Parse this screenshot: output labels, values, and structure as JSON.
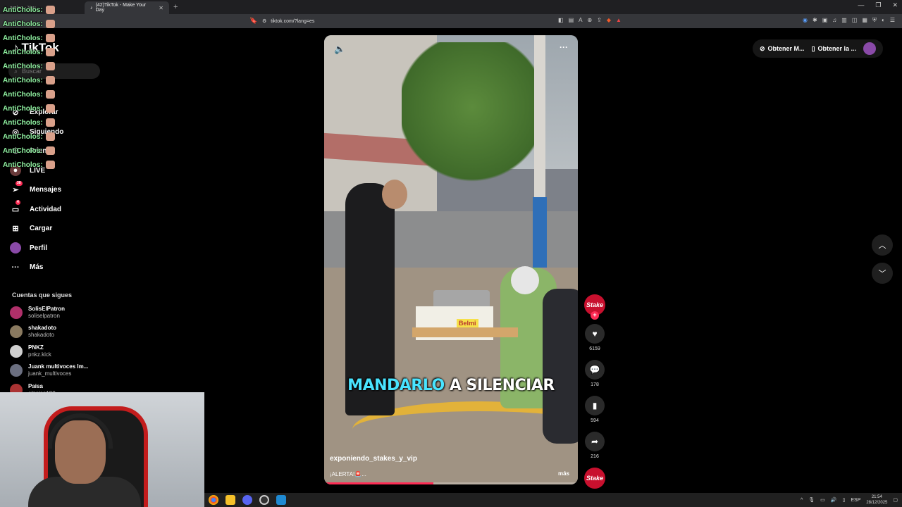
{
  "browser": {
    "tabs": [
      {
        "label": "...aming - You",
        "active": false
      },
      {
        "label": "(42)TikTok - Make Your Day",
        "active": true
      }
    ],
    "new_tab": "+",
    "url": "tiktok.com/?lang=es",
    "window_controls": [
      "—",
      "❐",
      "✕"
    ]
  },
  "tiktok": {
    "logo": "TikTok",
    "search_placeholder": "Buscar",
    "nav": [
      {
        "label": "Explorar",
        "icon": "compass-icon"
      },
      {
        "label": "Siguiendo",
        "icon": "following-icon"
      },
      {
        "label": "Friends",
        "icon": "friends-icon"
      },
      {
        "label": "LIVE",
        "icon": "live-icon"
      },
      {
        "label": "Mensajes",
        "icon": "messages-icon",
        "badge": "38"
      },
      {
        "label": "Actividad",
        "icon": "activity-icon",
        "badge": "4"
      },
      {
        "label": "Cargar",
        "icon": "upload-icon"
      },
      {
        "label": "Perfil",
        "icon": "profile-icon"
      },
      {
        "label": "Más",
        "icon": "more-icon"
      }
    ],
    "following_title": "Cuentas que sigues",
    "following": [
      {
        "name": "SolisElPatron",
        "handle": "soliselpatron",
        "color": "#b0306a"
      },
      {
        "name": "shakadoto",
        "handle": "shakadoto",
        "color": "#8a7a60"
      },
      {
        "name": "PNKZ",
        "handle": "pnkz.kick",
        "color": "#cfcfcf"
      },
      {
        "name": "Juank multivoces Im...",
        "handle": "juank_multivoces",
        "color": "#6b6f80"
      },
      {
        "name": "Paisa",
        "handle": "elpaisa100",
        "color": "#aa3333"
      }
    ],
    "top_right": {
      "coins_label": "Obtener M...",
      "app_label": "Obtener la ..."
    },
    "video": {
      "caption_highlight": "MANDARLO",
      "caption_rest": " A SILENCIAR",
      "username": "exponiendo_stakes_y_vip",
      "description": "¡ALERTA!🚨...",
      "more_label": "más",
      "box_brand": "Belmi",
      "progress": 0.43
    },
    "actions": {
      "creator_badge": "Stake",
      "likes": "6159",
      "comments": "178",
      "saves": "594",
      "shares": "216"
    }
  },
  "chat": {
    "lines": [
      "AntiCholos:",
      "AntiCholos:",
      "AntiCholos:",
      "AntiCholos:",
      "AntiCholos:",
      "AntiCholos:",
      "AntiCholos:",
      "AntiCholos:",
      "AntiCholos:",
      "AntiCholos:",
      "AntiCholos:",
      "AntiCholos:"
    ]
  },
  "taskbar": {
    "language": "ESP",
    "time": "21:54",
    "date": "28/12/2025"
  },
  "colors": {
    "accent": "#fe2c55",
    "caption_highlight": "#49e4ff",
    "chat_name": "#8ff0a0"
  }
}
